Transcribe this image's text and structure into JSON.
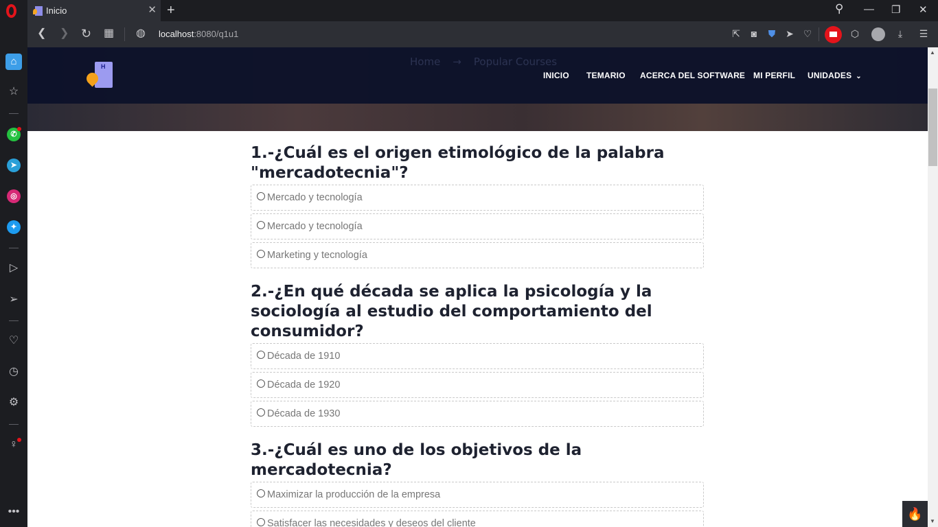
{
  "tab": {
    "title": "Inicio",
    "close": "✕",
    "new_tab": "+"
  },
  "window_controls": {
    "search": "⚲",
    "minimize": "—",
    "restore": "❐",
    "close": "✕"
  },
  "address_bar": {
    "url_host": "localhost",
    "url_rest": ":8080/q1u1"
  },
  "nav_icons": {
    "back": "❮",
    "forward": "❯",
    "reload": "↻",
    "tabs": "▦",
    "site_info": "◍"
  },
  "page": {
    "breadcrumb": [
      "Home",
      "→",
      "Popular Courses"
    ],
    "menu": {
      "inicio": "INICIO",
      "temario": "TEMARIO",
      "acerca": "ACERCA DEL SOFTWARE",
      "perfil": "MI PERFIL",
      "unidades": "UNIDADES",
      "unidades_caret": "⌄"
    },
    "questions": [
      {
        "text": "1.-¿Cuál es el origen etimológico de la palabra \"mercadotecnia\"?",
        "options": [
          "Mercado y tecnología",
          "Mercado y tecnología",
          "Marketing y tecnología"
        ]
      },
      {
        "text": "2.-¿En qué década se aplica la psicología y la sociología al estudio del comportamiento del consumidor?",
        "options": [
          "Década de 1910",
          "Década de 1920",
          "Década de 1930"
        ]
      },
      {
        "text": "3.-¿Cuál es uno de los objetivos de la mercadotecnia?",
        "options": [
          "Maximizar la producción de la empresa",
          "Satisfacer las necesidades y deseos del cliente"
        ]
      }
    ]
  },
  "colors": {
    "header": "#0c122a",
    "accent_red": "#e4141b",
    "sidebar_home": "#3d9ee8"
  }
}
